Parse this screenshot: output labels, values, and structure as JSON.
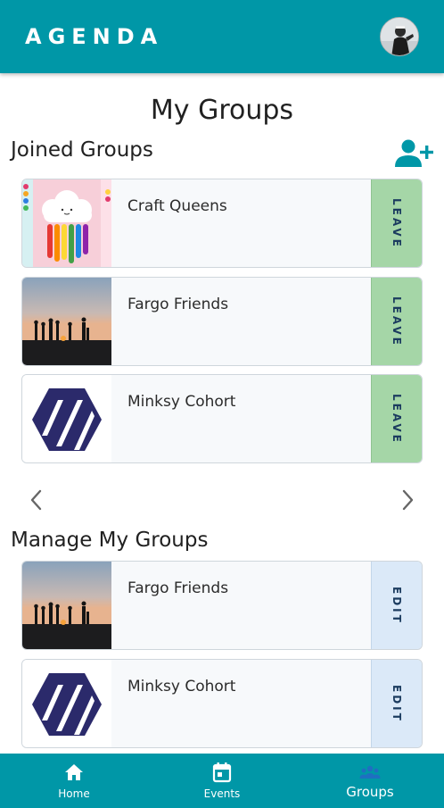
{
  "header": {
    "brand": "AGENDA"
  },
  "page": {
    "title": "My Groups"
  },
  "joined": {
    "title": "Joined Groups",
    "groups": [
      {
        "name": "Craft Queens",
        "action": "LEAVE",
        "image": "rainbow-cloud-craft"
      },
      {
        "name": "Fargo Friends",
        "action": "LEAVE",
        "image": "friends-sunset-silhouette"
      },
      {
        "name": "Minksy Cohort",
        "action": "LEAVE",
        "image": "hexagon-logo"
      }
    ]
  },
  "manage": {
    "title": "Manage My Groups",
    "groups": [
      {
        "name": "Fargo Friends",
        "action": "EDIT",
        "image": "friends-sunset-silhouette"
      },
      {
        "name": "Minksy Cohort",
        "action": "EDIT",
        "image": "hexagon-logo"
      }
    ]
  },
  "nav": {
    "items": [
      {
        "label": "Home",
        "icon": "home-icon"
      },
      {
        "label": "Events",
        "icon": "calendar-icon"
      },
      {
        "label": "Groups",
        "icon": "groups-icon",
        "active": true
      }
    ]
  },
  "colors": {
    "primary": "#0097a7",
    "leave": "#a5d6a7",
    "edit": "#dbe9f8",
    "logo": "#2b2a6b"
  }
}
